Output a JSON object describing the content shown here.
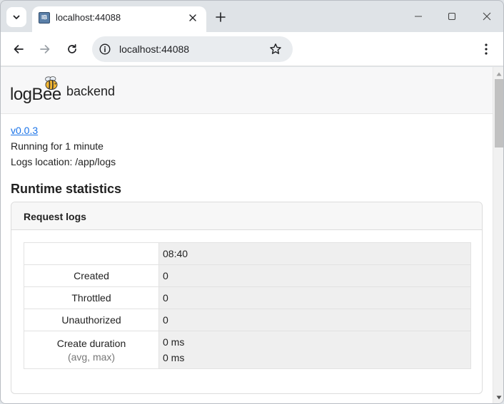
{
  "browser": {
    "tab_title": "localhost:44088",
    "url": "localhost:44088"
  },
  "app": {
    "logo_text": "logBee",
    "name": "backend",
    "version_link": "v0.0.3",
    "running": "Running for 1 minute",
    "logs_location": "Logs location: /app/logs"
  },
  "runtime": {
    "title": "Runtime statistics",
    "card_title": "Request logs",
    "time_header": "08:40",
    "rows": [
      {
        "label": "Created",
        "value": "0"
      },
      {
        "label": "Throttled",
        "value": "0"
      },
      {
        "label": "Unauthorized",
        "value": "0"
      }
    ],
    "duration": {
      "label": "Create duration",
      "sublabel": "(avg, max)",
      "avg": "0 ms",
      "max": "0 ms"
    }
  }
}
